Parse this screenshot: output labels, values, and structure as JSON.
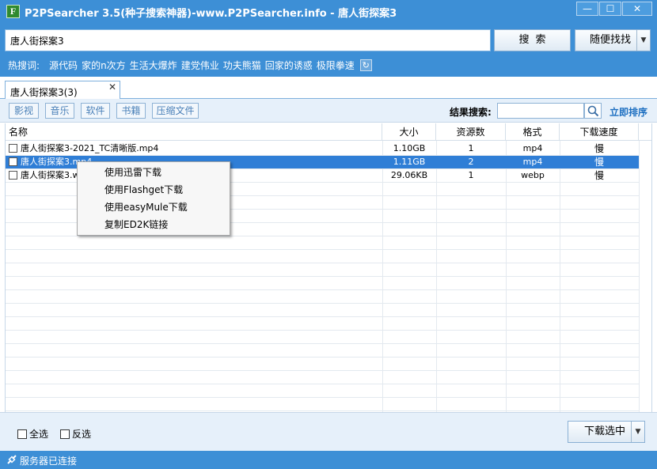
{
  "window": {
    "title": "P2PSearcher 3.5(种子搜索神器)-www.P2PSearcher.info - 唐人街探案3",
    "logo_letter": "F",
    "minimize": "—",
    "maximize": "☐",
    "close": "✕"
  },
  "search": {
    "query": "唐人街探案3",
    "search_label": "搜索",
    "random_label": "随便找找"
  },
  "hot": {
    "label": "热搜词:",
    "items": [
      "源代码",
      "家的n次方",
      "生活大爆炸",
      "建党伟业",
      "功夫熊猫",
      "回家的诱惑",
      "极限拳速"
    ]
  },
  "tab": {
    "label": "唐人街探案3(3)",
    "close": "✕"
  },
  "filters": [
    "影视",
    "音乐",
    "软件",
    "书籍",
    "压缩文件"
  ],
  "result_search": {
    "label": "结果搜索:",
    "sort_label": "立即排序"
  },
  "table": {
    "columns": [
      "名称",
      "大小",
      "资源数",
      "格式",
      "下载速度"
    ],
    "rows": [
      {
        "name": "唐人街探案3-2021_TC清晰版.mp4",
        "size": "1.10GB",
        "sources": "1",
        "format": "mp4",
        "speed": "慢",
        "selected": false
      },
      {
        "name": "唐人街探案3.mp4",
        "size": "1.11GB",
        "sources": "2",
        "format": "mp4",
        "speed": "慢",
        "selected": true
      },
      {
        "name": "唐人街探案3.webp",
        "size": "29.06KB",
        "sources": "1",
        "format": "webp",
        "speed": "慢",
        "selected": false
      }
    ]
  },
  "context_menu": [
    "使用迅雷下载",
    "使用Flashget下载",
    "使用easyMule下载",
    "复制ED2K链接"
  ],
  "bottom": {
    "select_all": "全选",
    "invert": "反选",
    "download_label": "下载选中"
  },
  "status": {
    "text": "服务器已连接"
  },
  "colors": {
    "accent": "#3d8fd6",
    "selection": "#2f7ed6",
    "link": "#1d6fc1"
  }
}
